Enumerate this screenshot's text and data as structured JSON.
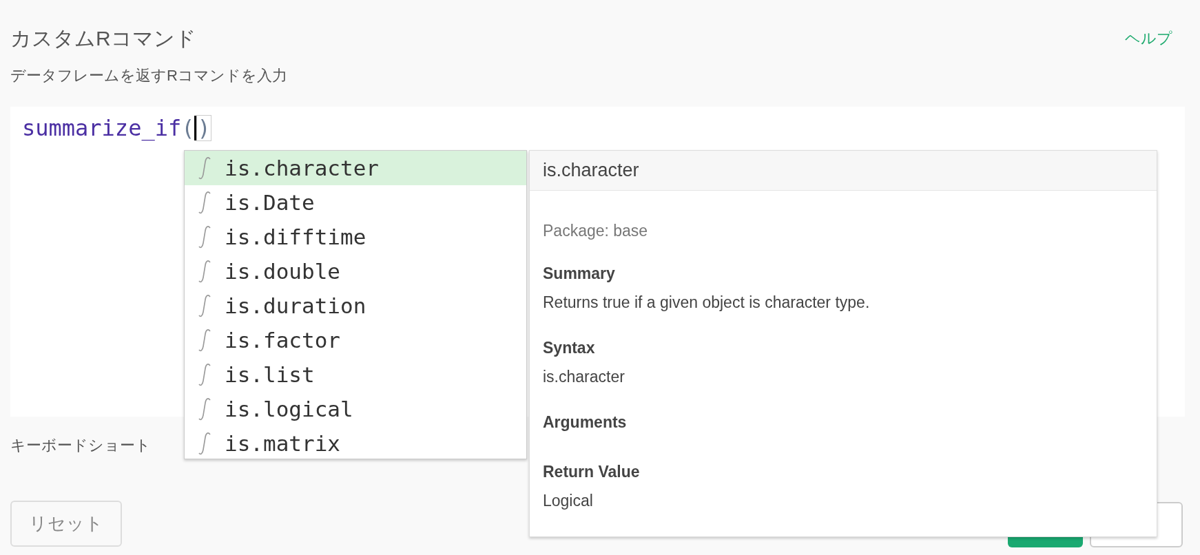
{
  "header": {
    "title": "カスタムRコマンド",
    "help_link": "ヘルプ",
    "subtitle": "データフレームを返すRコマンドを入力"
  },
  "editor": {
    "function_name": "summarize_if",
    "open_paren": "(",
    "close_paren": ")"
  },
  "autocomplete": {
    "items": [
      {
        "label": "is.character",
        "selected": true
      },
      {
        "label": "is.Date",
        "selected": false
      },
      {
        "label": "is.difftime",
        "selected": false
      },
      {
        "label": "is.double",
        "selected": false
      },
      {
        "label": "is.duration",
        "selected": false
      },
      {
        "label": "is.factor",
        "selected": false
      },
      {
        "label": "is.list",
        "selected": false
      },
      {
        "label": "is.logical",
        "selected": false
      },
      {
        "label": "is.matrix",
        "selected": false
      }
    ]
  },
  "doc": {
    "title": "is.character",
    "package": "Package: base",
    "sections": [
      {
        "heading": "Summary",
        "body": "Returns true if a given object is character type."
      },
      {
        "heading": "Syntax",
        "body": "is.character"
      },
      {
        "heading": "Arguments"
      },
      {
        "heading": "Return Value",
        "body": "Logical"
      }
    ]
  },
  "shortcut_label": "キーボードショート",
  "reset_button": "リセット"
}
